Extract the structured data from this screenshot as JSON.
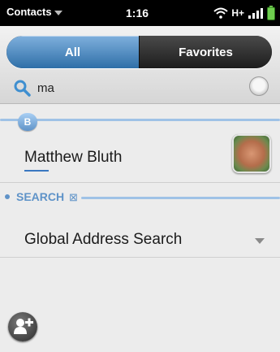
{
  "statusbar": {
    "app_menu_label": "Contacts",
    "time": "1:16",
    "network_label": "H+",
    "icons": [
      "wifi-icon",
      "signal-bars-icon",
      "battery-icon"
    ]
  },
  "tabs": [
    {
      "label": "All",
      "active": true
    },
    {
      "label": "Favorites",
      "active": false
    }
  ],
  "search": {
    "value": "ma",
    "icon": "search-icon"
  },
  "sections": {
    "b_letter": "B",
    "search_label": "SEARCH",
    "search_expand_glyph": "⊠"
  },
  "contacts": [
    {
      "name": "Matthew Bluth",
      "avatar_icon": "contact-photo"
    }
  ],
  "global_search": {
    "label": "Global Address Search"
  },
  "colors": {
    "accent_blue": "#5f93c8",
    "active_tab": "#3a78c1"
  }
}
